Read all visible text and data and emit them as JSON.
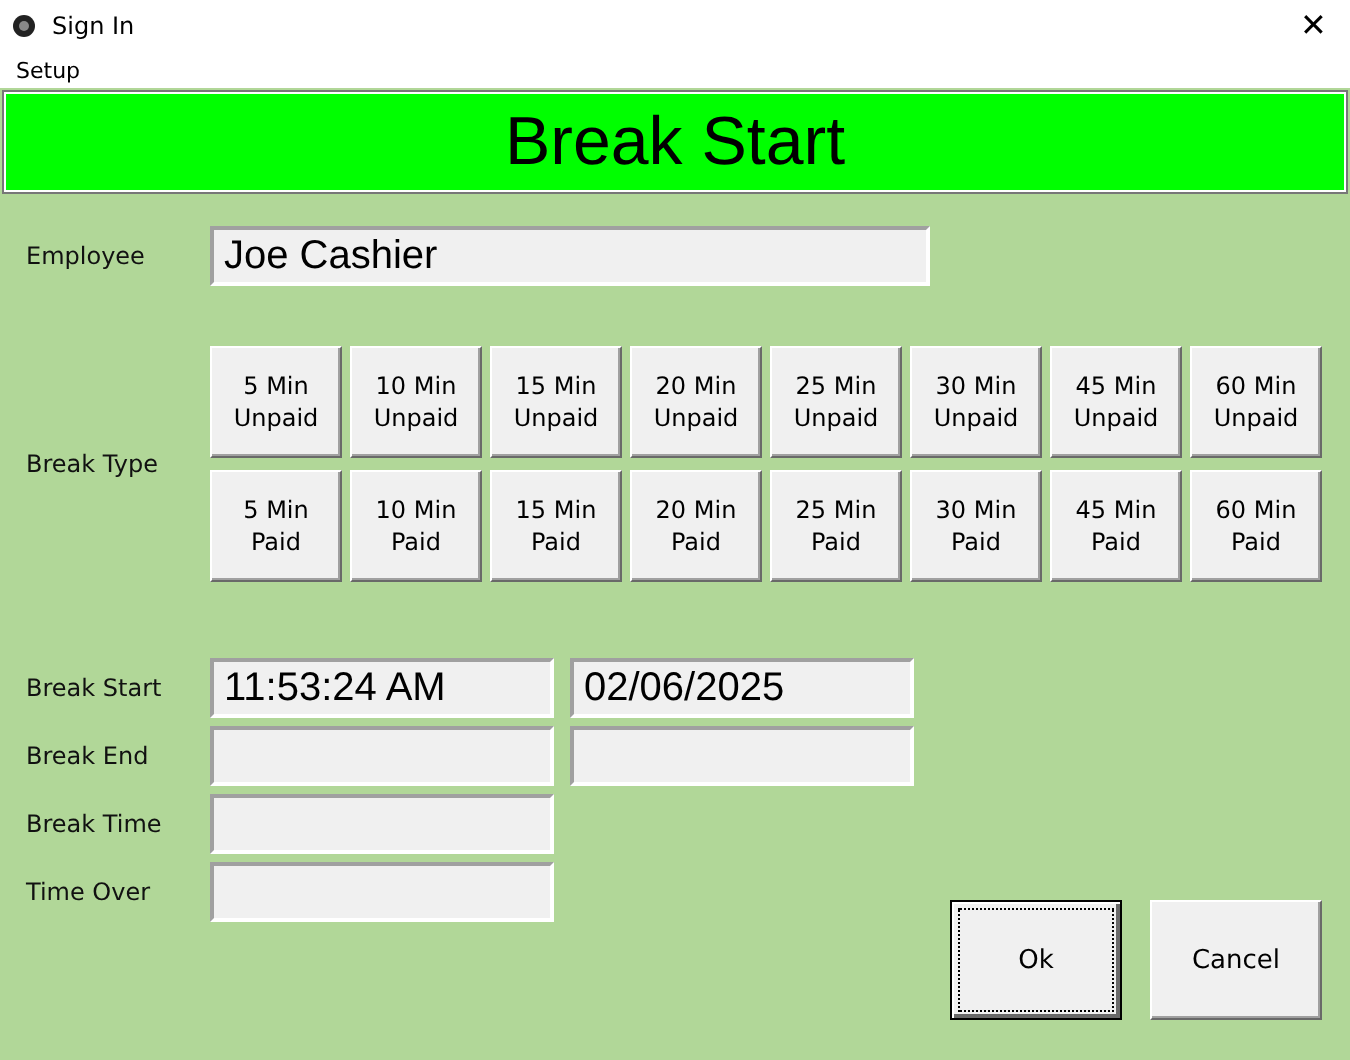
{
  "window": {
    "title": "Sign In",
    "close": "✕"
  },
  "menu": [
    "Setup"
  ],
  "banner": "Break Start",
  "employee": {
    "label": "Employee",
    "value": "Joe Cashier"
  },
  "break_type": {
    "label": "Break Type",
    "rows": [
      [
        "5 Min\nUnpaid",
        "10 Min\nUnpaid",
        "15 Min\nUnpaid",
        "20 Min\nUnpaid",
        "25 Min\nUnpaid",
        "30 Min\nUnpaid",
        "45 Min\nUnpaid",
        "60 Min\nUnpaid"
      ],
      [
        "5 Min\nPaid",
        "10 Min\nPaid",
        "15 Min\nPaid",
        "20 Min\nPaid",
        "25 Min\nPaid",
        "30 Min\nPaid",
        "45 Min\nPaid",
        "60 Min\nPaid"
      ]
    ]
  },
  "times": [
    {
      "label": "Break Start",
      "fields": [
        {
          "kind": "text",
          "value": "11:53:24 AM"
        },
        {
          "kind": "text",
          "value": "02/06/2025"
        }
      ]
    },
    {
      "label": "Break End",
      "fields": [
        {
          "kind": "empty"
        },
        {
          "kind": "empty"
        }
      ]
    },
    {
      "label": "Break Time",
      "fields": [
        {
          "kind": "empty"
        }
      ]
    },
    {
      "label": "Time Over",
      "fields": [
        {
          "kind": "empty"
        }
      ]
    }
  ],
  "buttons": [
    {
      "label": "Ok",
      "focused": true
    },
    {
      "label": "Cancel",
      "focused": false
    }
  ]
}
